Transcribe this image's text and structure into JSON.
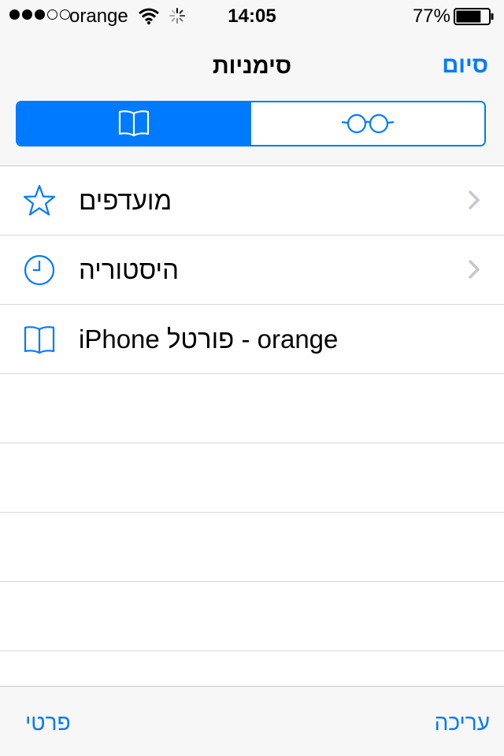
{
  "status_bar": {
    "signal_dots_filled": 3,
    "signal_dots_total": 5,
    "carrier": "orange",
    "time": "14:05",
    "battery_percent": "77%",
    "battery_level": 0.77
  },
  "nav": {
    "title": "סימניות",
    "done_label": "סיום"
  },
  "segments": [
    {
      "icon": "book-icon",
      "selected": true
    },
    {
      "icon": "glasses-icon",
      "selected": false
    }
  ],
  "list": {
    "items": [
      {
        "label": "מועדפים",
        "icon": "star-icon",
        "has_chevron": true
      },
      {
        "label": "היסטוריה",
        "icon": "clock-icon",
        "has_chevron": true
      },
      {
        "label": "iPhone פורטל - orange",
        "icon": "book-icon",
        "has_chevron": false
      }
    ],
    "empty_rows": 4
  },
  "toolbar": {
    "edit_label": "עריכה",
    "private_label": "פרטי"
  },
  "colors": {
    "accent": "#007aff",
    "chevron": "#c7c7cc",
    "separator": "#d9d9dc",
    "bar_background": "#f7f7f8"
  }
}
